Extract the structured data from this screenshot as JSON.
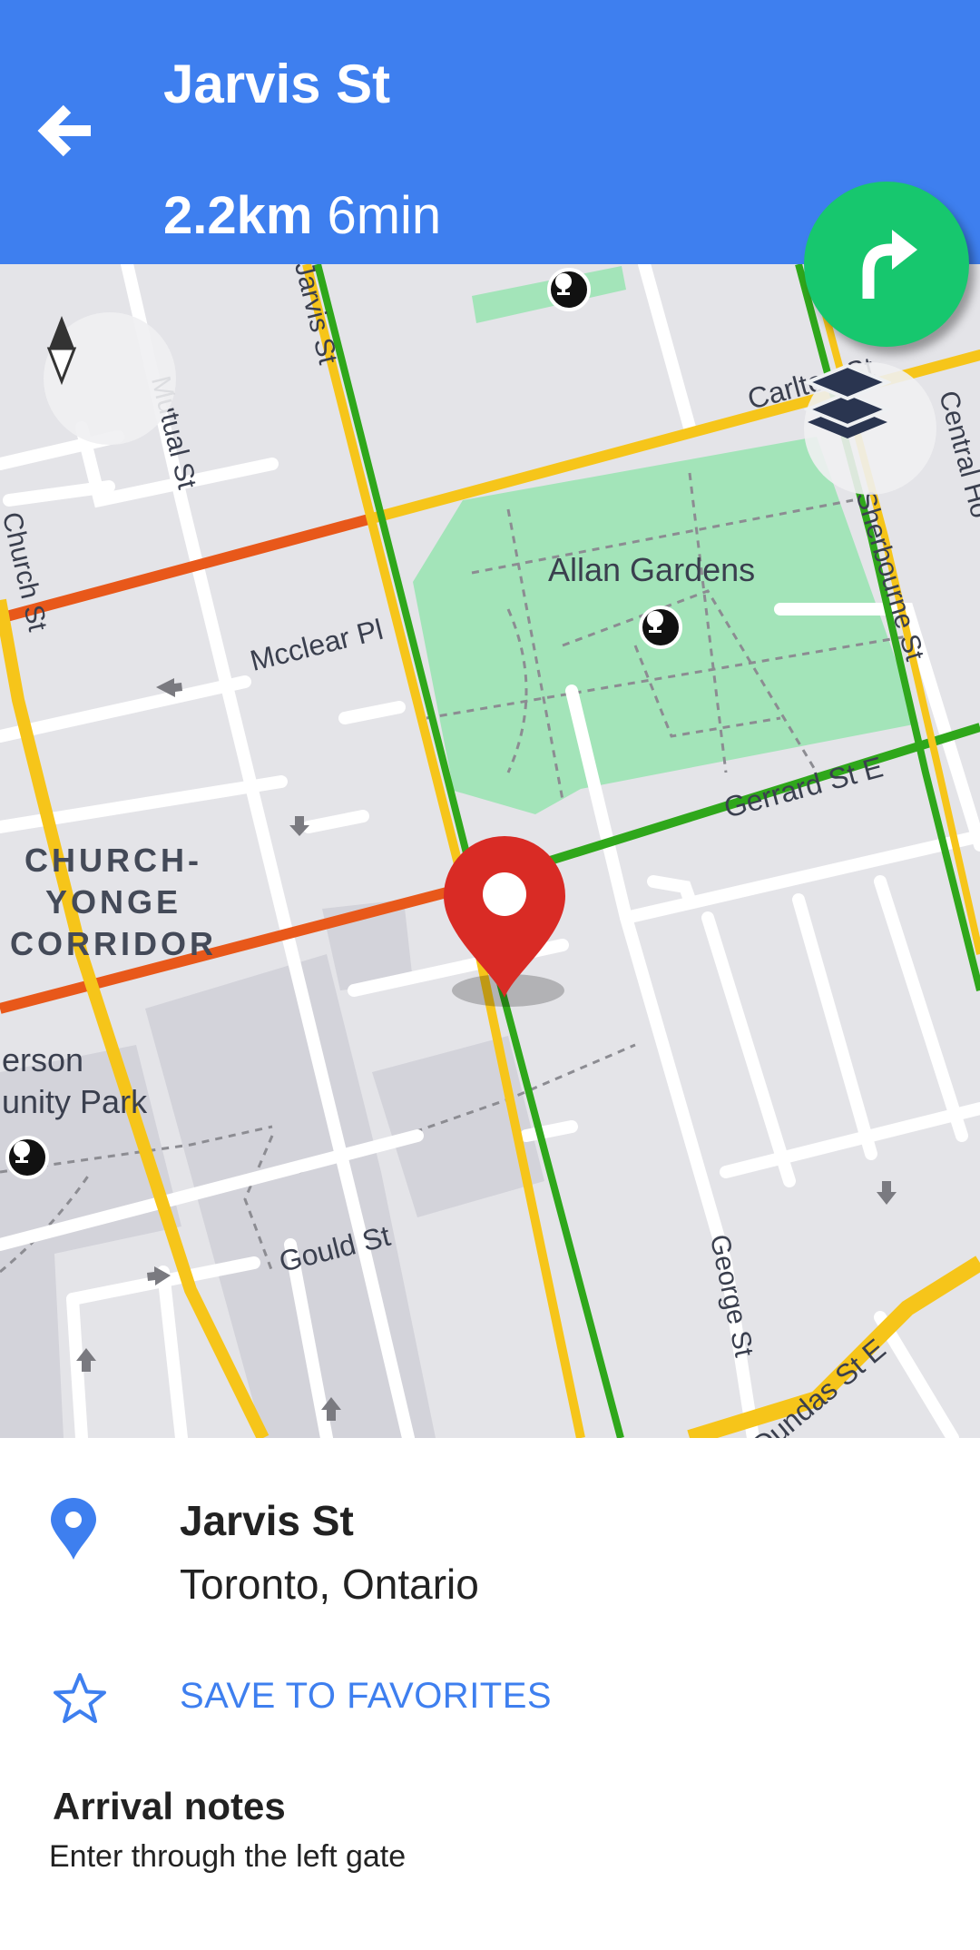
{
  "header": {
    "title": "Jarvis St",
    "distance": "2.2km",
    "duration": "6min",
    "background_color": "#3e7fef"
  },
  "icons": {
    "back": "arrow-left-icon",
    "turn": "turn-right-icon",
    "compass": "compass-icon",
    "layers": "layers-icon",
    "location": "location-pin-icon",
    "favorite": "star-outline-icon",
    "destination": "map-marker-icon"
  },
  "map": {
    "street_labels": {
      "jarvis": "Jarvis St",
      "mutual": "Mutual St",
      "carlton": "Carlton St",
      "central": "Central Ho",
      "sherbourne": "Sherbourne St",
      "church": "Church St",
      "mcclear": "Mcclear Pl",
      "gerrard": "Gerrard St E",
      "george": "George St",
      "gould": "Gould St",
      "dundas": "Dundas St E"
    },
    "place_labels": {
      "allan_gardens": "Allan Gardens",
      "park_line1": "erson",
      "park_line2": "unity Park"
    },
    "district": [
      "CHURCH-",
      "YONGE",
      "CORRIDOR"
    ],
    "colors": {
      "traffic_free": "#2fa71b",
      "traffic_moderate": "#f6c51a",
      "traffic_heavy": "#e8581a",
      "park": "#a3e4b9",
      "marker": "#d92b25"
    }
  },
  "sheet": {
    "location_name": "Jarvis St",
    "location_city": "Toronto, Ontario",
    "save_label": "SAVE TO FAVORITES",
    "notes_title": "Arrival notes",
    "notes_text": "Enter through the left gate",
    "accent_color": "#3e7fef"
  }
}
